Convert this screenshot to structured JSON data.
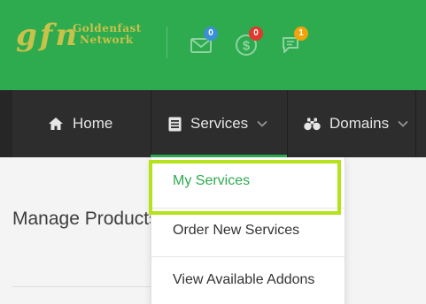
{
  "logo": {
    "mark": "gfn",
    "line1": "Goldenfast",
    "line2": "Network"
  },
  "header_icons": [
    {
      "name": "mail-icon",
      "badge": "0",
      "badge_color": "#3b8fd4"
    },
    {
      "name": "dollar-icon",
      "badge": "0",
      "badge_color": "#e0392f"
    },
    {
      "name": "chat-icon",
      "badge": "1",
      "badge_color": "#f0a30a"
    }
  ],
  "nav": {
    "home": "Home",
    "services": "Services",
    "domains": "Domains"
  },
  "dropdown": {
    "items": [
      "My Services",
      "Order New Services",
      "View Available Addons"
    ],
    "active_index": 0
  },
  "page": {
    "title": "Manage Products"
  },
  "colors": {
    "brand_green": "#2eaa4f",
    "nav_dark": "#2d2d2d",
    "highlight": "#b6e21a",
    "logo_gold": "#c9c24a"
  }
}
